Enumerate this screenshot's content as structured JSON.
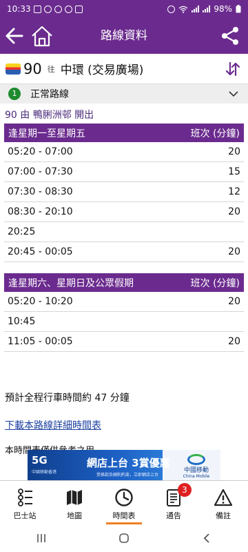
{
  "status_bar": {
    "time": "10:33",
    "battery": "98%"
  },
  "app_bar": {
    "title": "路線資料"
  },
  "route": {
    "number": "90",
    "direction_word": "往",
    "destination": "中環 (交易廣場)"
  },
  "route_status": {
    "index": "1",
    "text": "正常路線"
  },
  "departure_info": "90 由 鴨脷洲邨 開出",
  "timetables": [
    {
      "header_day": "逢星期一至星期五",
      "header_freq": "班次 (分鐘)",
      "rows": [
        {
          "period": "05:20 - 07:00",
          "freq": "20"
        },
        {
          "period": "07:00 - 07:30",
          "freq": "15"
        },
        {
          "period": "07:30 - 08:30",
          "freq": "12"
        },
        {
          "period": "08:30 - 20:10",
          "freq": "20"
        },
        {
          "period": "20:25",
          "freq": ""
        },
        {
          "period": "20:45 - 00:05",
          "freq": "20"
        }
      ]
    },
    {
      "header_day": "逢星期六、星期日及公眾假期",
      "header_freq": "班次 (分鐘)",
      "rows": [
        {
          "period": "05:20 - 10:20",
          "freq": "20"
        },
        {
          "period": "10:45",
          "freq": ""
        },
        {
          "period": "11:05 - 00:05",
          "freq": "20"
        }
      ]
    }
  ],
  "journey_time_note": "預計全程行車時間約 47 分鐘",
  "download_link": "下載本路線詳細時間表",
  "disclaimer": "本時間表僅供參考之用",
  "ad": {
    "brand_5g": "5G",
    "brand_5g_sub": "中國移動香港",
    "headline": "網店上台 3賞優惠",
    "subline": "受條款及細則約束，立即網店上台",
    "carrier_zh": "中國移動",
    "carrier_en": "China Mobile"
  },
  "bottom_nav": [
    {
      "label": "巴士站",
      "icon": "bus-stop-list-icon"
    },
    {
      "label": "地圖",
      "icon": "map-icon"
    },
    {
      "label": "時間表",
      "icon": "clock-icon",
      "active": true
    },
    {
      "label": "通告",
      "icon": "notice-document-icon",
      "badge": "3"
    },
    {
      "label": "備註",
      "icon": "warning-icon"
    }
  ],
  "colors": {
    "primary": "#6b2b8e",
    "active_tab": "#ef7f22",
    "link": "#1a3fa0",
    "badge": "#e02020",
    "route_status": "#1f8a2e"
  }
}
